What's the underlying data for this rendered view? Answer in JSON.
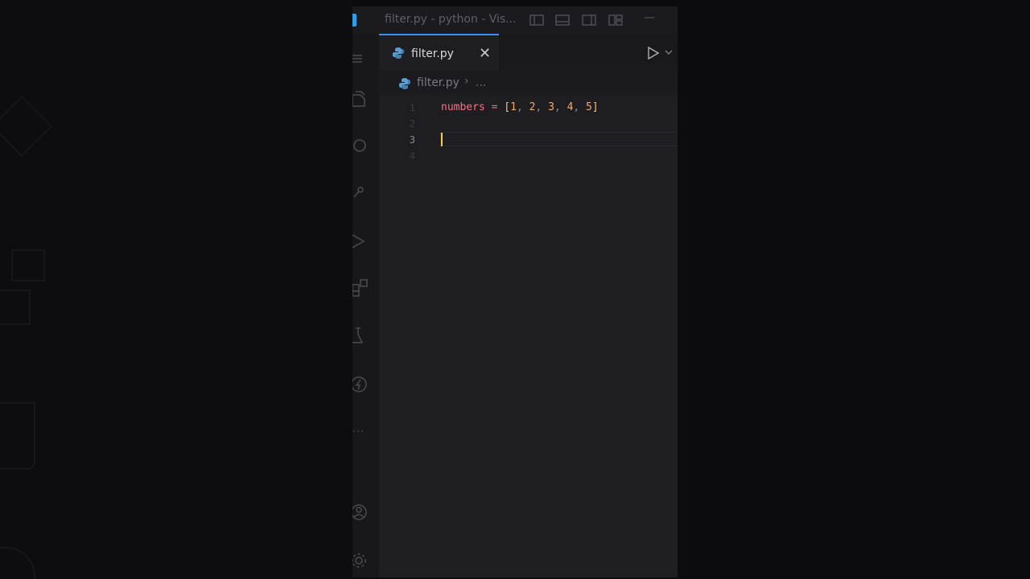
{
  "window": {
    "title": "filter.py - python - Vis..."
  },
  "tab": {
    "label": "filter.py",
    "close_glyph": "✕"
  },
  "breadcrumb": {
    "file": "filter.py",
    "separator": "›",
    "more": "..."
  },
  "editor": {
    "lines": [
      {
        "number": "1"
      },
      {
        "number": "2"
      },
      {
        "number": "3"
      },
      {
        "number": "4"
      }
    ],
    "code": {
      "variable": "numbers",
      "operator": "=",
      "open_bracket": "[",
      "close_bracket": "]",
      "values": [
        "1",
        "2",
        "3",
        "4",
        "5"
      ],
      "comma": ","
    },
    "active_line": "3"
  },
  "activity_bar": {
    "icons": [
      "explorer-icon",
      "search-icon",
      "source-control-icon",
      "run-debug-icon",
      "extensions-icon",
      "testing-icon",
      "remote-icon",
      "more-icon",
      "account-icon",
      "settings-icon"
    ],
    "more_glyph": "···"
  },
  "colors": {
    "accent": "#3b8eea",
    "cursor": "#f2c94c",
    "variable": "#ff6b7a",
    "number": "#f9a766",
    "editor_bg": "#1e1e22"
  }
}
